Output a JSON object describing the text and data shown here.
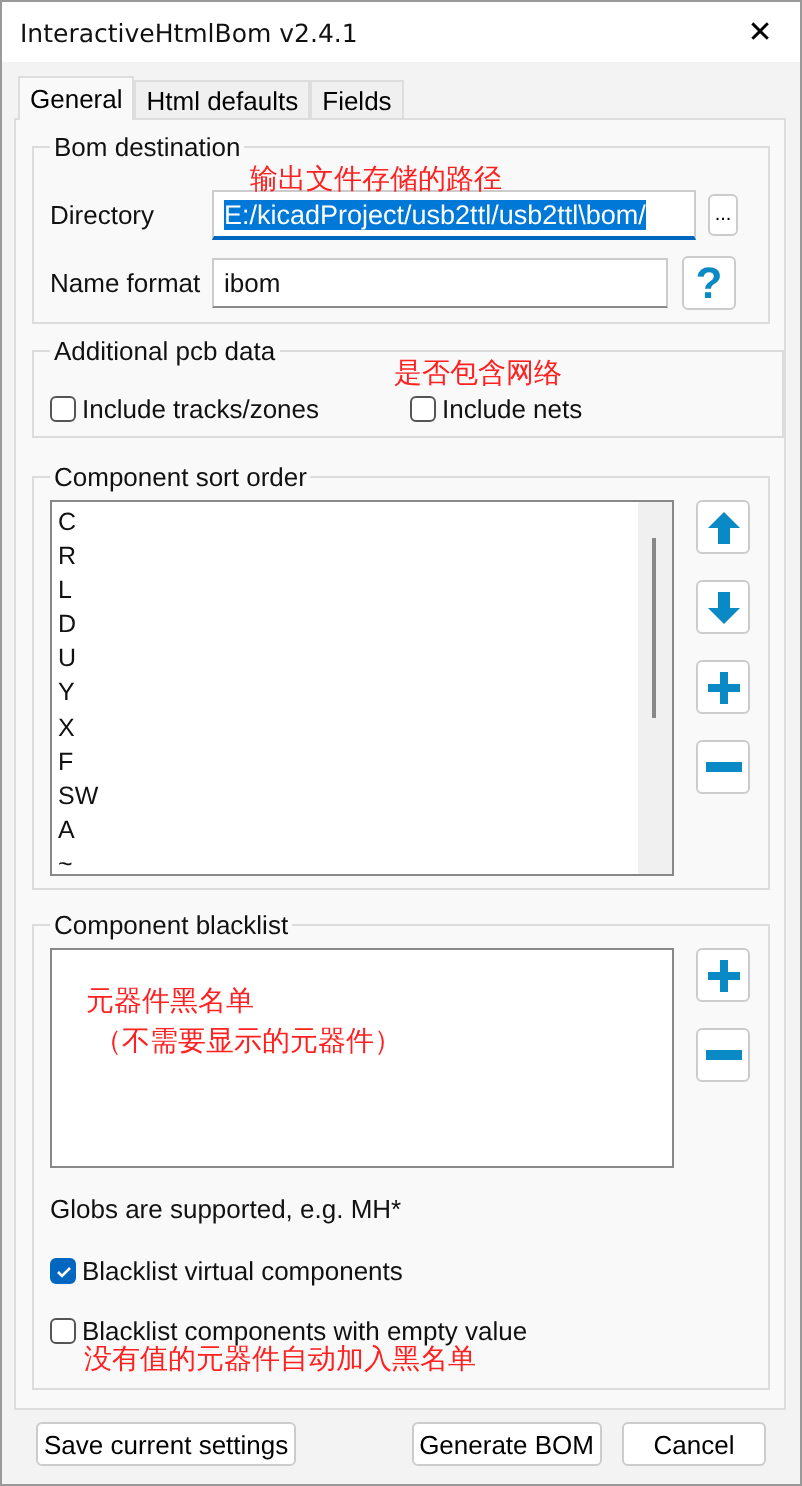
{
  "window": {
    "title": "InteractiveHtmlBom v2.4.1",
    "close": "✕"
  },
  "tabs": [
    {
      "label": "General",
      "selected": true
    },
    {
      "label": "Html defaults",
      "selected": false
    },
    {
      "label": "Fields",
      "selected": false
    }
  ],
  "bom_destination": {
    "title": "Bom destination",
    "annotation": "输出文件存储的路径",
    "directory": {
      "label": "Directory",
      "value": "E:/kicadProject/usb2ttl/usb2ttl\\bom/",
      "browse": "...",
      "focused": true
    },
    "name_format": {
      "label": "Name format",
      "value": "ibom",
      "help": "?"
    }
  },
  "additional_pcb_data": {
    "title": "Additional pcb data",
    "annotation": "是否包含网络",
    "options": [
      {
        "label": "Include tracks/zones",
        "checked": false
      },
      {
        "label": "Include nets",
        "checked": false
      }
    ]
  },
  "sort_order": {
    "title": "Component sort order",
    "items": [
      "C",
      "R",
      "L",
      "D",
      "U",
      "Y",
      "X",
      "F",
      "SW",
      "A",
      "~"
    ],
    "buttons": [
      {
        "kind": "up"
      },
      {
        "kind": "down"
      },
      {
        "kind": "add"
      },
      {
        "kind": "remove"
      }
    ]
  },
  "blacklist": {
    "title": "Component blacklist",
    "annotations": [
      "元器件黑名单",
      "（不需要显示的元器件）"
    ],
    "buttons": [
      {
        "kind": "add"
      },
      {
        "kind": "remove"
      }
    ],
    "hint": "Globs are supported, e.g. MH*",
    "options": [
      {
        "label": "Blacklist virtual components",
        "checked": true
      },
      {
        "label": "Blacklist components with empty value",
        "checked": false
      }
    ],
    "annotation": "没有值的元器件自动加入黑名单"
  },
  "footer": {
    "buttons": [
      "Save current settings",
      "Generate BOM",
      "Cancel"
    ]
  }
}
